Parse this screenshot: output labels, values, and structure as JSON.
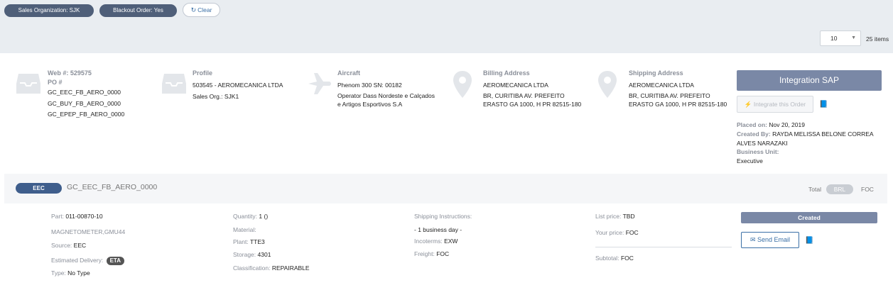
{
  "filters": {
    "chip1": "Sales Organization: SJK",
    "chip2": "Blackout Order: Yes",
    "clear_label": "Clear"
  },
  "pagination": {
    "page_size": "10",
    "items_count": "25 items"
  },
  "order": {
    "web_label": "Web #: 529575",
    "po_label": "PO #",
    "po_numbers": [
      "GC_EEC_FB_AERO_0000",
      "GC_BUY_FB_AERO_0000",
      "GC_EPEP_FB_AERO_0000"
    ],
    "profile_title": "Profile",
    "profile_name": "503545 - AEROMECANICA LTDA",
    "sales_org": "Sales Org.: SJK1",
    "aircraft_title": "Aircraft",
    "aircraft_model": "Phenom 300 SN: 00182",
    "aircraft_operator": "Operator Dass Nordeste e Calçados e Artigos Esportivos S.A",
    "billing_title": "Billing Address",
    "billing_name": "AEROMECANICA LTDA",
    "billing_address": "BR, CURITIBA AV. PREFEITO ERASTO GA 1000, H PR 82515-180",
    "shipping_title": "Shipping Address",
    "shipping_name": "AEROMECANICA LTDA",
    "shipping_address": "BR, CURITIBA AV. PREFEITO ERASTO GA 1000, H PR 82515-180",
    "integration_sap": "Integration SAP",
    "integrate_order": "Integrate this Order",
    "placed_on_label": "Placed on:",
    "placed_on_value": "Nov 20, 2019",
    "created_by_label": "Created By:",
    "created_by_value": "RAYDA MELISSA BELONE CORREA ALVES NARAZAKI",
    "business_unit_label": "Business Unit:",
    "business_unit_value": "Executive"
  },
  "line": {
    "badge": "EEC",
    "title": "GC_EEC_FB_AERO_0000",
    "total_label": "Total",
    "currency": "BRL",
    "total_value": "FOC",
    "part_label": "Part:",
    "part_value": "011-00870-10",
    "description": "MAGNETOMETER,GMU44",
    "source_label": "Source:",
    "source_value": "EEC",
    "est_delivery_label": "Estimated Delivery:",
    "eta_badge": "ETA",
    "type_label": "Type:",
    "type_value": "No Type",
    "quantity_label": "Quantity:",
    "quantity_value": "1 ()",
    "material_label": "Material:",
    "plant_label": "Plant:",
    "plant_value": "TTE3",
    "storage_label": "Storage:",
    "storage_value": "4301",
    "classification_label": "Classification:",
    "classification_value": "REPAIRABLE",
    "shipping_instr_label": "Shipping Instructions:",
    "shipping_instr_value": "- 1 business day -",
    "incoterms_label": "Incoterms:",
    "incoterms_value": "EXW",
    "freight_label": "Freight:",
    "freight_value": "FOC",
    "list_price_label": "List price:",
    "list_price_value": "TBD",
    "your_price_label": "Your price:",
    "your_price_value": "FOC",
    "subtotal_label": "Subtotal:",
    "subtotal_value": "FOC",
    "status": "Created",
    "send_email": "Send Email"
  }
}
